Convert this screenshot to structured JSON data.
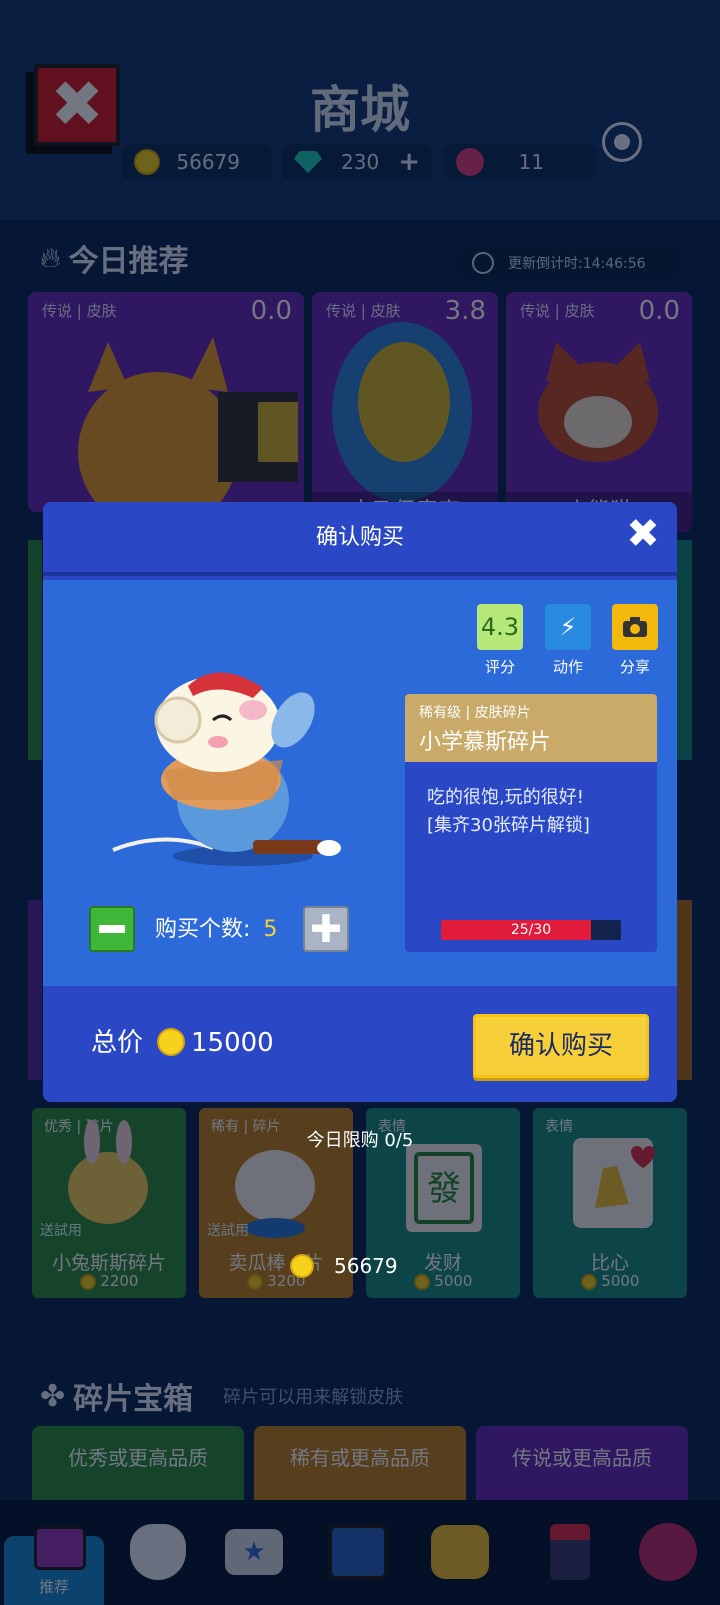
{
  "header": {
    "title": "商城",
    "close_icon": "close-icon",
    "record_icon": "record-icon"
  },
  "currency": {
    "coins": "56679",
    "gems": "230",
    "gem_plus": "+",
    "lotus": "11"
  },
  "today": {
    "title": "今日推荐",
    "timer": "更新倒计时:14:46:56"
  },
  "featured": [
    {
      "tag": "传说",
      "type": "皮肤",
      "score": "0.0",
      "name": ""
    },
    {
      "tag": "传说",
      "type": "皮肤",
      "score": "3.8",
      "name": "木乃伊奇克"
    },
    {
      "tag": "传说",
      "type": "皮肤",
      "score": "0.0",
      "name": "小熊猫"
    }
  ],
  "modal": {
    "title": "确认购买",
    "rating": "4.3",
    "rating_label": "评分",
    "action_label": "动作",
    "share_label": "分享",
    "rarity": "稀有级",
    "item_type": "皮肤碎片",
    "item_name": "小学慕斯碎片",
    "desc_line1": "吃的很饱,玩的很好!",
    "desc_line2": "[集齐30张碎片解锁]",
    "progress_text": "25/30",
    "progress": 0.8333,
    "qty_label": "购买个数:",
    "qty_value": "5",
    "total_label": "总价",
    "total_value": "15000",
    "confirm_label": "确认购买"
  },
  "limit": {
    "text": "今日限购 0/5",
    "balance": "56679"
  },
  "shop_items": [
    {
      "tag": "优秀",
      "type": "碎片",
      "badge": "送試用",
      "name": "小兔斯斯碎片",
      "price": "2200"
    },
    {
      "tag": "稀有",
      "type": "碎片",
      "badge": "送試用",
      "name": "卖瓜棒",
      "name_tail": "片",
      "price": "3200"
    },
    {
      "tag": "表情",
      "type": "",
      "badge": "",
      "name": "发财",
      "price": "5000"
    },
    {
      "tag": "表情",
      "type": "",
      "badge": "",
      "name": "比心",
      "price": "5000"
    }
  ],
  "chests": {
    "title": "碎片宝箱",
    "subtitle": "碎片可以用来解锁皮肤",
    "items": [
      "优秀或更高品质",
      "稀有或更高品质",
      "传说或更高品质"
    ]
  },
  "nav": {
    "active_label": "推荐"
  },
  "colors": {
    "modal_bg": "#2a47c6",
    "modal_body": "#2b6ad8",
    "confirm": "#f7cf38",
    "coin": "#f7d21c",
    "progress": "#e01b3c"
  }
}
